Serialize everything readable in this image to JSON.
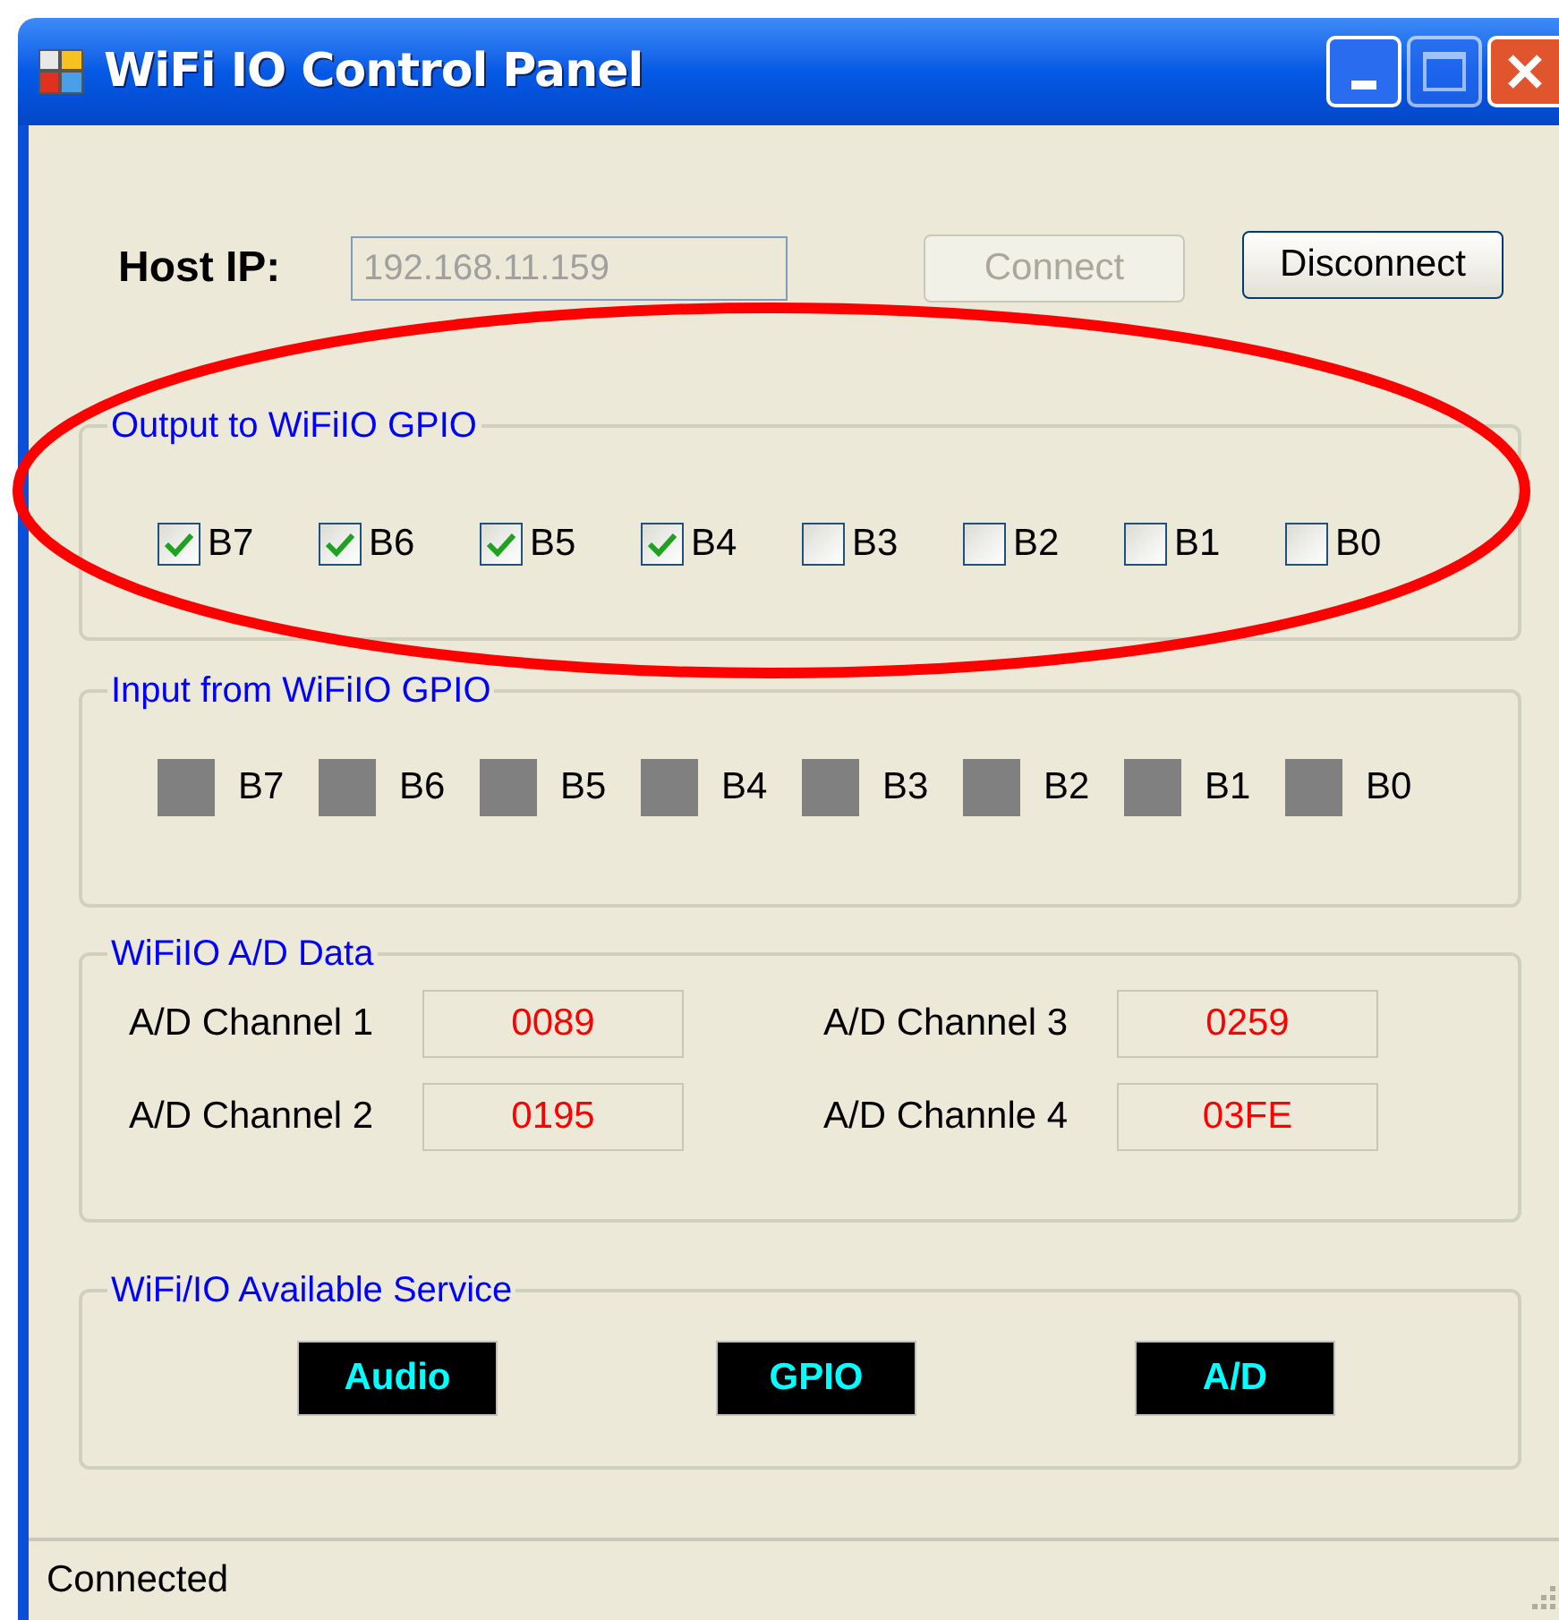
{
  "window": {
    "title": "WiFi IO Control Panel"
  },
  "host": {
    "label": "Host IP:",
    "value": "192.168.11.159",
    "disabled": true
  },
  "buttons": [
    {
      "label": "Connect",
      "disabled": true
    },
    {
      "label": "Disconnect",
      "disabled": false
    }
  ],
  "output_group": {
    "title": "Output to WiFiIO GPIO",
    "bits": [
      {
        "label": "B7",
        "checked": true
      },
      {
        "label": "B6",
        "checked": true
      },
      {
        "label": "B5",
        "checked": true
      },
      {
        "label": "B4",
        "checked": true
      },
      {
        "label": "B3",
        "checked": false
      },
      {
        "label": "B2",
        "checked": false
      },
      {
        "label": "B1",
        "checked": false
      },
      {
        "label": "B0",
        "checked": false
      }
    ]
  },
  "input_group": {
    "title": "Input from WiFiIO GPIO",
    "bits": [
      {
        "label": "B7",
        "on": false
      },
      {
        "label": "B6",
        "on": false
      },
      {
        "label": "B5",
        "on": false
      },
      {
        "label": "B4",
        "on": false
      },
      {
        "label": "B3",
        "on": false
      },
      {
        "label": "B2",
        "on": false
      },
      {
        "label": "B1",
        "on": false
      },
      {
        "label": "B0",
        "on": false
      }
    ]
  },
  "ad_group": {
    "title": "WiFiIO A/D Data",
    "channels": [
      {
        "label": "A/D Channel 1",
        "value": "0089"
      },
      {
        "label": "A/D Channel 3",
        "value": "0259"
      },
      {
        "label": "A/D Channel 2",
        "value": "0195"
      },
      {
        "label": "A/D Channle 4",
        "value": "03FE"
      }
    ]
  },
  "service_group": {
    "title": "WiFi/IO Available Service",
    "services": [
      "Audio",
      "GPIO",
      "A/D"
    ]
  },
  "status_bar": {
    "text": "Connected"
  }
}
